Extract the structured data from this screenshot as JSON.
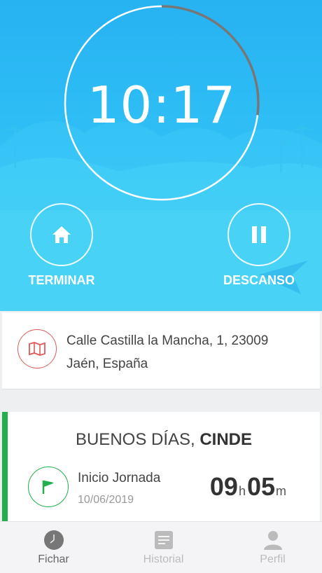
{
  "clock": {
    "time": "10:17",
    "progress_fraction": 0.27
  },
  "actions": {
    "terminar_label": "TERMINAR",
    "descanso_label": "DESCANSO"
  },
  "location": {
    "line1": "Calle Castilla la Mancha, 1, 23009",
    "line2": "Jaén, España",
    "icon": "map-icon"
  },
  "greeting": {
    "prefix": "BUENOS DÍAS, ",
    "name": "CINDE",
    "start_label": "Inicio Jornada",
    "start_date": "10/06/2019",
    "elapsed_hours": "09",
    "hours_unit": "h",
    "elapsed_minutes": "05",
    "minutes_unit": "m"
  },
  "nav": {
    "fichar": "Fichar",
    "historial": "Historial",
    "perfil": "Perfil"
  },
  "colors": {
    "accent_green": "#21b04b",
    "accent_red": "#e05a5a",
    "sky_blue": "#27b2f2"
  }
}
